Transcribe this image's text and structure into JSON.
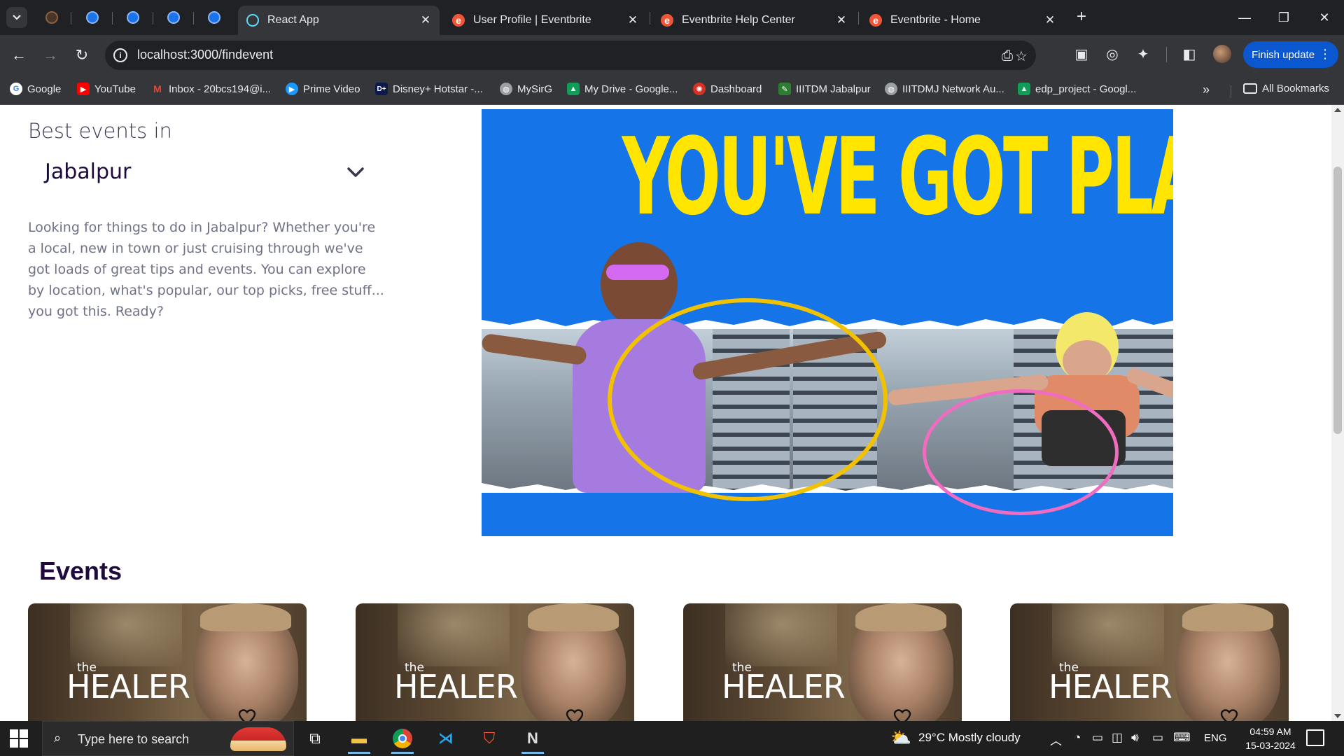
{
  "browser": {
    "tabs": [
      {
        "title": "React App",
        "active": true,
        "favicon": "react-icon"
      },
      {
        "title": "User Profile | Eventbrite",
        "active": false,
        "favicon": "eventbrite-icon"
      },
      {
        "title": "Eventbrite Help Center",
        "active": false,
        "favicon": "eventbrite-icon"
      },
      {
        "title": "Eventbrite - Home",
        "active": false,
        "favicon": "eventbrite-icon"
      }
    ],
    "url": "localhost:3000/findevent",
    "finish_update_label": "Finish update",
    "bookmarks": [
      {
        "label": "Google",
        "icon": "google-icon",
        "color": "#4285f4"
      },
      {
        "label": "YouTube",
        "icon": "youtube-icon",
        "color": "#ff0000"
      },
      {
        "label": "Inbox - 20bcs194@i...",
        "icon": "gmail-icon",
        "color": "#ea4335"
      },
      {
        "label": "Prime Video",
        "icon": "prime-video-icon",
        "color": "#1a98ff"
      },
      {
        "label": "Disney+ Hotstar -...",
        "icon": "hotstar-icon",
        "color": "#0c1a4b"
      },
      {
        "label": "MySirG",
        "icon": "globe-icon",
        "color": "#9aa0a6"
      },
      {
        "label": "My Drive - Google...",
        "icon": "google-drive-icon",
        "color": "#0f9d58"
      },
      {
        "label": "Dashboard",
        "icon": "dashboard-icon",
        "color": "#d93025"
      },
      {
        "label": "IIITDM Jabalpur",
        "icon": "iiitdm-icon",
        "color": "#2e7d32"
      },
      {
        "label": "IIITDMJ Network Au...",
        "icon": "globe-icon",
        "color": "#9aa0a6"
      },
      {
        "label": "edp_project - Googl...",
        "icon": "google-drive-icon",
        "color": "#0f9d58"
      }
    ],
    "all_bookmarks_label": "All Bookmarks"
  },
  "page": {
    "best_events_label": "Best events in",
    "city": "Jabalpur",
    "intro": "Looking for things to do in Jabalpur? Whether you're a local, new in town or just cruising through we've got loads of great tips and events. You can explore by location, what's popular, our top picks, free stuff... you got this. Ready?",
    "hero": {
      "headline": "YOU'VE GOT PLANS",
      "bg_color": "#1474e8",
      "text_color": "#ffe500"
    },
    "events_title": "Events",
    "events": [
      {
        "small": "the",
        "title": "HEALER"
      },
      {
        "small": "the",
        "title": "HEALER"
      },
      {
        "small": "the",
        "title": "HEALER"
      },
      {
        "small": "the",
        "title": "HEALER"
      }
    ]
  },
  "taskbar": {
    "search_placeholder": "Type here to search",
    "weather": "29°C  Mostly cloudy",
    "language": "ENG",
    "time": "04:59 AM",
    "date": "15-03-2024"
  }
}
